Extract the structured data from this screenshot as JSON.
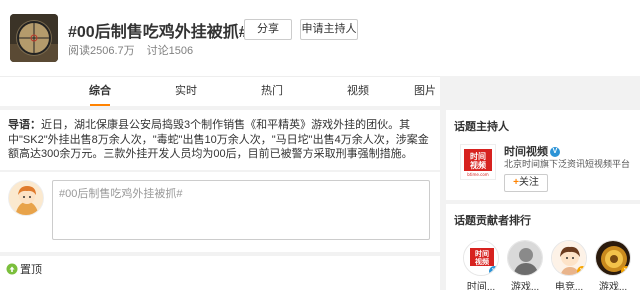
{
  "topic": {
    "title": "#00后制售吃鸡外挂被抓#",
    "share_label": "分享",
    "apply_host_label": "申请主持人",
    "reads": "阅读2506.7万",
    "discussions": "讨论1506"
  },
  "tabs": [
    {
      "label": "综合",
      "active": true
    },
    {
      "label": "实时",
      "active": false
    },
    {
      "label": "热门",
      "active": false
    },
    {
      "label": "视频",
      "active": false
    },
    {
      "label": "图片",
      "active": false
    }
  ],
  "intro": {
    "prefix": "导语：",
    "text": "近日，湖北保康县公安局捣毁3个制作销售《和平精英》游戏外挂的团伙。其中\"SK2\"外挂出售8万余人次，\"毒蛇\"出售10万余人次，\"马日坨\"出售4万余人次，涉案金额高达300余万元。三款外挂开发人员均为00后，目前已被警方采取刑事强制措施。"
  },
  "composer": {
    "value": "#00后制售吃鸡外挂被抓#"
  },
  "pinned": {
    "label": "置顶"
  },
  "host_panel": {
    "title": "话题主持人",
    "logo_text_top": "时间",
    "logo_text_bottom": "视频",
    "logo_small": "btime.com",
    "name": "时间视频",
    "description": "北京时间旗下泛资讯短视频平台",
    "follow_label": "关注",
    "follow_plus": "+"
  },
  "contributors_panel": {
    "title": "话题贡献者排行",
    "items": [
      {
        "name": "时间...",
        "badge": "V"
      },
      {
        "name": "游戏...",
        "badge": ""
      },
      {
        "name": "电竞...",
        "badge": "V"
      },
      {
        "name": "游戏...",
        "badge": "V"
      }
    ]
  },
  "colors": {
    "accent": "#ff8200",
    "verify_blue": "#2b93d6",
    "verify_yellow": "#f7a500",
    "logo_red": "#d7221f"
  }
}
